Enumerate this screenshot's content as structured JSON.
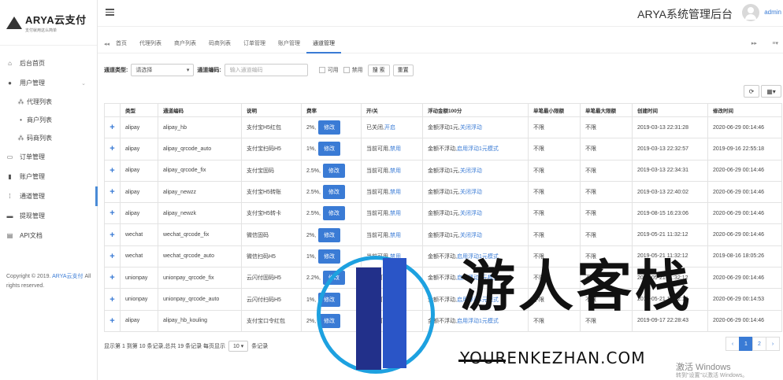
{
  "brand": {
    "title": "ARYA云支付",
    "subtitle": "支付就用这么简单"
  },
  "header": {
    "title": "ARYA系统管理后台",
    "user": "admin"
  },
  "sidebar": {
    "items": [
      {
        "label": "后台首页",
        "icon": "home-icon"
      },
      {
        "label": "用户管理",
        "icon": "user-icon"
      },
      {
        "label": "代理列表",
        "icon": "users-icon",
        "sub": true
      },
      {
        "label": "商户列表",
        "icon": "user-icon",
        "sub": true
      },
      {
        "label": "码商列表",
        "icon": "users-icon",
        "sub": true
      },
      {
        "label": "订单管理",
        "icon": "cart-icon"
      },
      {
        "label": "账户管理",
        "icon": "money-icon"
      },
      {
        "label": "通道管理",
        "icon": "road-icon",
        "active": true
      },
      {
        "label": "提现管理",
        "icon": "credit-icon"
      },
      {
        "label": "API文档",
        "icon": "doc-icon"
      }
    ],
    "copyright": "Copyright © 2019. ",
    "copyright_link": "ARYA云支付",
    "rights": " All rights reserved."
  },
  "tabs": [
    "首页",
    "代理列表",
    "商户列表",
    "码商列表",
    "订单管理",
    "账户管理",
    "通道管理"
  ],
  "filter": {
    "type_label": "通道类型:",
    "type_value": "请选择",
    "code_label": "通道编码:",
    "code_placeholder": "输入通道编码",
    "available": "可用",
    "disabled": "禁用",
    "search": "搜 索",
    "reset": "重置"
  },
  "table": {
    "headers": [
      "类型",
      "通道编码",
      "说明",
      "费率",
      "开/关",
      "浮动金额100分",
      "单笔最小限额",
      "单笔最大限额",
      "创建时间",
      "修改时间"
    ],
    "edit_label": "修改",
    "rows": [
      {
        "type": "alipay",
        "code": "alipay_hb",
        "desc": "支付宝H5红包",
        "rate": "2%,",
        "status": "已关闭,",
        "status_link": "开启",
        "float": "金额浮动1元,",
        "float_link": "关闭浮动",
        "min": "不限",
        "max": "不限",
        "created": "2019-03-13 22:31:28",
        "modified": "2020-06-29 00:14:46"
      },
      {
        "type": "alipay",
        "code": "alipay_qrcode_auto",
        "desc": "支付宝扫码H5",
        "rate": "1%,",
        "status": "当前可用,",
        "status_link": "禁用",
        "float": "金额不浮动,",
        "float_link": "启用浮动1元模式",
        "min": "不限",
        "max": "不限",
        "created": "2019-03-13 22:32:57",
        "modified": "2019-09-16 22:55:18"
      },
      {
        "type": "alipay",
        "code": "alipay_qrcode_fix",
        "desc": "支付宝固码",
        "rate": "2.5%,",
        "status": "当前可用,",
        "status_link": "禁用",
        "float": "金额浮动1元,",
        "float_link": "关闭浮动",
        "min": "不限",
        "max": "不限",
        "created": "2019-03-13 22:34:31",
        "modified": "2020-06-29 00:14:46"
      },
      {
        "type": "alipay",
        "code": "alipay_newzz",
        "desc": "支付宝H5转账",
        "rate": "2.5%,",
        "status": "当前可用,",
        "status_link": "禁用",
        "float": "金额浮动1元,",
        "float_link": "关闭浮动",
        "min": "不限",
        "max": "不限",
        "created": "2019-03-13 22:40:02",
        "modified": "2020-06-29 00:14:46"
      },
      {
        "type": "alipay",
        "code": "alipay_newzk",
        "desc": "支付宝H5转卡",
        "rate": "2.5%,",
        "status": "当前可用,",
        "status_link": "禁用",
        "float": "金额浮动1元,",
        "float_link": "关闭浮动",
        "min": "不限",
        "max": "不限",
        "created": "2019-08-15 16:23:06",
        "modified": "2020-06-29 00:14:46"
      },
      {
        "type": "wechat",
        "code": "wechat_qrcode_fix",
        "desc": "微信固码",
        "rate": "2%,",
        "status": "当前可用,",
        "status_link": "禁用",
        "float": "金额浮动1元,",
        "float_link": "关闭浮动",
        "min": "不限",
        "max": "不限",
        "created": "2019-05-21 11:32:12",
        "modified": "2020-06-29 00:14:46"
      },
      {
        "type": "wechat",
        "code": "wechat_qrcode_auto",
        "desc": "微信扫码H5",
        "rate": "1%,",
        "status": "当前可用,",
        "status_link": "禁用",
        "float": "金额不浮动,",
        "float_link": "启用浮动1元模式",
        "min": "不限",
        "max": "不限",
        "created": "2019-05-21 11:32:12",
        "modified": "2019-08-16 18:05:26"
      },
      {
        "type": "unionpay",
        "code": "unionpay_qrcode_fix",
        "desc": "云闪付固码H5",
        "rate": "2.2%,",
        "status": "当前可用,",
        "status_link": "禁用",
        "float": "金额不浮动,",
        "float_link": "启用浮动1元模式",
        "min": "不限",
        "max": "不限",
        "created": "2019-05-21 11:32:12",
        "modified": "2020-06-29 00:14:46"
      },
      {
        "type": "unionpay",
        "code": "unionpay_qrcode_auto",
        "desc": "云闪付扫码H5",
        "rate": "1%,",
        "status": "当前可用,",
        "status_link": "禁用",
        "float": "金额不浮动,",
        "float_link": "启用浮动1元模式",
        "min": "不限",
        "max": "不限",
        "created": "2019-05-21 11:32:12",
        "modified": "2020-06-29 00:14:53"
      },
      {
        "type": "alipay",
        "code": "alipay_hb_kouling",
        "desc": "支付宝口令红包",
        "rate": "2%,",
        "status": "当前可用,",
        "status_link": "禁用",
        "float": "金额不浮动,",
        "float_link": "启用浮动1元模式",
        "min": "不限",
        "max": "不限",
        "created": "2019-09-17 22:28:43",
        "modified": "2020-06-29 00:14:46"
      }
    ]
  },
  "footer": {
    "summary": "显示第 1 到第 10 条记录,总共 19 条记录 每页显示",
    "page_size": "10",
    "suffix": "条记录"
  },
  "pager": [
    "‹",
    "1",
    "2",
    "›"
  ],
  "watermark": {
    "text": "游人客栈",
    "url": "YOURENKEZHAN.COM"
  },
  "windows": {
    "line1": "激活 Windows",
    "line2": "转到\"设置\"以激活 Windows。"
  }
}
